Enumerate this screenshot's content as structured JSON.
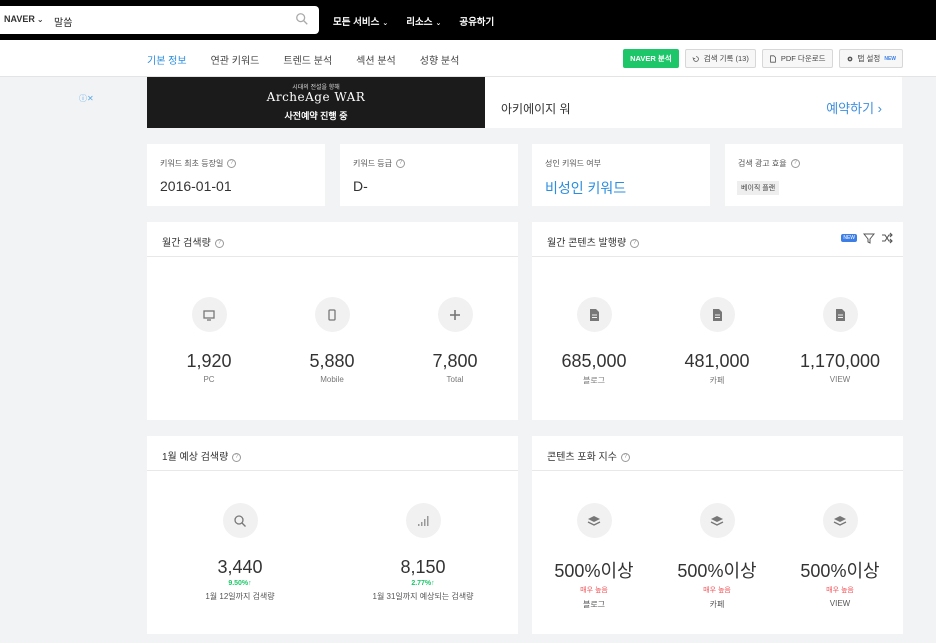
{
  "topbar": {
    "engine": "NAVER",
    "query": "말씀",
    "nav": [
      "모든 서비스",
      "리소스",
      "공유하기"
    ]
  },
  "tabs": [
    "기본 정보",
    "연관 키워드",
    "트렌드 분석",
    "섹션 분석",
    "성향 분석"
  ],
  "actions": {
    "naver": "NAVER 분석",
    "history": "검색 기록 (13)",
    "pdf": "PDF 다운로드",
    "settings": "탭 설정",
    "new_badge": "NEW"
  },
  "ad": {
    "banner_sub": "시대의 전설을 향해",
    "banner_logo": "ArcheAge WAR",
    "banner_cta": "사전예약 진행 중",
    "title": "아키에이지 워",
    "link": "예약하기 ›"
  },
  "info": [
    {
      "label": "키워드 최초 등장일",
      "value": "2016-01-01"
    },
    {
      "label": "키워드 등급",
      "value": "D-"
    },
    {
      "label": "성인 키워드 여부",
      "value": "비성인 키워드"
    },
    {
      "label": "검색 광고 효율",
      "value": "베이직 플랜"
    }
  ],
  "monthly_search": {
    "title": "월간 검색량",
    "stats": [
      {
        "value": "1,920",
        "label": "PC",
        "icon": "desktop-icon"
      },
      {
        "value": "5,880",
        "label": "Mobile",
        "icon": "mobile-icon"
      },
      {
        "value": "7,800",
        "label": "Total",
        "icon": "plus-icon"
      }
    ]
  },
  "monthly_content": {
    "title": "월간 콘텐츠 발행량",
    "new_badge": "NEW",
    "stats": [
      {
        "value": "685,000",
        "label": "블로그",
        "icon": "document-icon"
      },
      {
        "value": "481,000",
        "label": "카페",
        "icon": "document-icon"
      },
      {
        "value": "1,170,000",
        "label": "VIEW",
        "icon": "document-icon"
      }
    ]
  },
  "forecast": {
    "title": "1월 예상 검색량",
    "stats": [
      {
        "value": "3,440",
        "change": "9.50%↑",
        "label": "1월 12일까지 검색량",
        "icon": "search-icon"
      },
      {
        "value": "8,150",
        "change": "2.77%↑",
        "label": "1월 31일까지 예상되는 검색량",
        "icon": "signal-icon"
      }
    ]
  },
  "saturation": {
    "title": "콘텐츠 포화 지수",
    "stats": [
      {
        "value": "500%이상",
        "level": "매우 높음",
        "label": "블로그",
        "icon": "layers-icon"
      },
      {
        "value": "500%이상",
        "level": "매우 높음",
        "label": "카페",
        "icon": "layers-icon"
      },
      {
        "value": "500%이상",
        "level": "매우 높음",
        "label": "VIEW",
        "icon": "layers-icon"
      }
    ]
  },
  "colors": {
    "accent": "#2a8de0",
    "naver_green": "#1ec66a",
    "warning_red": "#f2565a"
  }
}
